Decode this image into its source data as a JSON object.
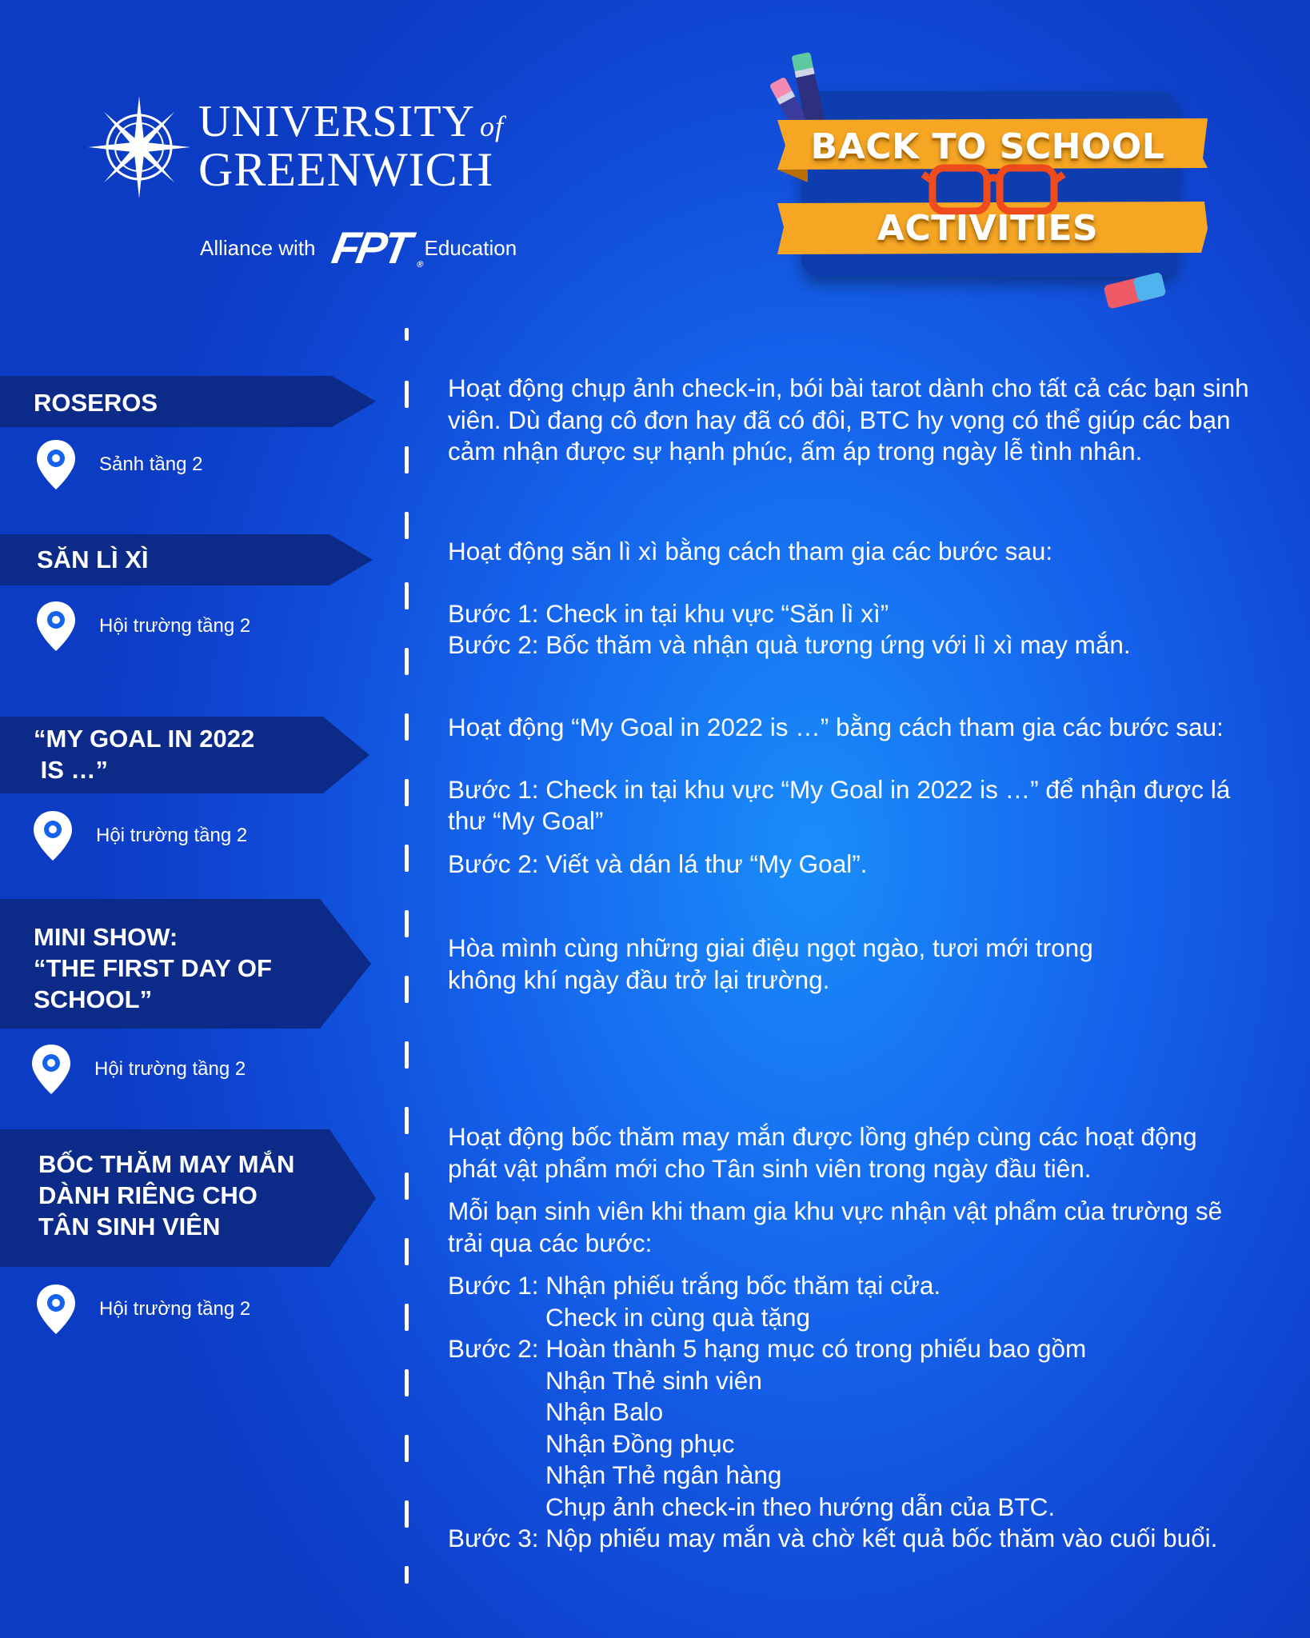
{
  "brand": {
    "university_line1": "UNIVERSITY",
    "university_of": "of",
    "university_line2": "GREENWICH",
    "alliance_prefix": "Alliance with",
    "alliance_brand": "FPT",
    "alliance_suffix": "Education"
  },
  "badge": {
    "line1": "BACK TO SCHOOL",
    "line2": "ACTIVITIES"
  },
  "colors": {
    "background": "#1563ec",
    "banner": "#0c2a88",
    "ribbon": "#f6a623",
    "badge_card": "#0e3cae",
    "glasses": "#f04b1d"
  },
  "activities": [
    {
      "title_lines": [
        "ROSEROS"
      ],
      "location": "Sảnh tầng 2",
      "description": [
        "Hoạt động chụp ảnh check-in, bói bài tarot dành cho tất cả các bạn sinh",
        "viên. Dù đang cô đơn hay đã có đôi, BTC hy vọng có thể giúp các bạn",
        "cảm nhận được sự hạnh phúc, ấm áp trong ngày lễ tình nhân."
      ]
    },
    {
      "title_lines": [
        "SĂN LÌ XÌ"
      ],
      "location": "Hội trường tầng 2",
      "intro": "Hoạt động săn lì xì bằng cách tham gia các bước sau:",
      "steps": [
        "Bước 1: Check in tại khu vực “Săn lì xì”",
        "Bước 2: Bốc thăm và nhận quà tương ứng với lì xì may mắn."
      ]
    },
    {
      "title_lines": [
        "“MY GOAL IN 2022",
        " IS …”"
      ],
      "location": "Hội trường tầng 2",
      "intro": "Hoạt động “My Goal in 2022 is …” bằng cách tham gia các bước sau:",
      "step1_lines": [
        "Bước 1: Check in tại khu vực “My Goal in 2022 is …” để nhận được lá",
        "thư “My Goal”"
      ],
      "step2": "Bước 2: Viết và dán lá thư “My Goal”."
    },
    {
      "title_lines": [
        "MINI SHOW:",
        "“THE FIRST DAY OF",
        "SCHOOL”"
      ],
      "location": "Hội trường tầng 2",
      "description": [
        "Hòa mình cùng những giai điệu ngọt ngào, tươi mới trong",
        "không khí ngày đầu trở lại trường."
      ]
    },
    {
      "title_lines": [
        "BỐC THĂM MAY MẮN",
        "DÀNH RIÊNG CHO",
        "TÂN SINH VIÊN"
      ],
      "location": "Hội trường tầng 2",
      "para1": [
        "Hoạt động bốc thăm may mắn được lồng ghép cùng các hoạt động",
        "phát vật phẩm mới cho Tân sinh viên trong ngày đầu tiên."
      ],
      "para2": [
        "Mỗi bạn sinh viên khi tham gia khu vực nhận vật phẩm của trường sẽ",
        "trải qua các bước:"
      ],
      "step1": "Bước 1: Nhận phiếu trắng bốc thăm tại cửa.",
      "step1_sub": [
        "Check in cùng quà tặng"
      ],
      "step2": "Bước 2: Hoàn thành 5 hạng mục có trong phiếu bao gồm",
      "step2_sub": [
        "Nhận Thẻ sinh viên",
        "Nhận Balo",
        "Nhận Đồng phục",
        "Nhận Thẻ ngân hàng",
        "Chụp ảnh check-in theo hướng dẫn của BTC."
      ],
      "step3": "Bước 3: Nộp phiếu may mắn và chờ kết quả bốc thăm vào cuối buổi."
    }
  ]
}
